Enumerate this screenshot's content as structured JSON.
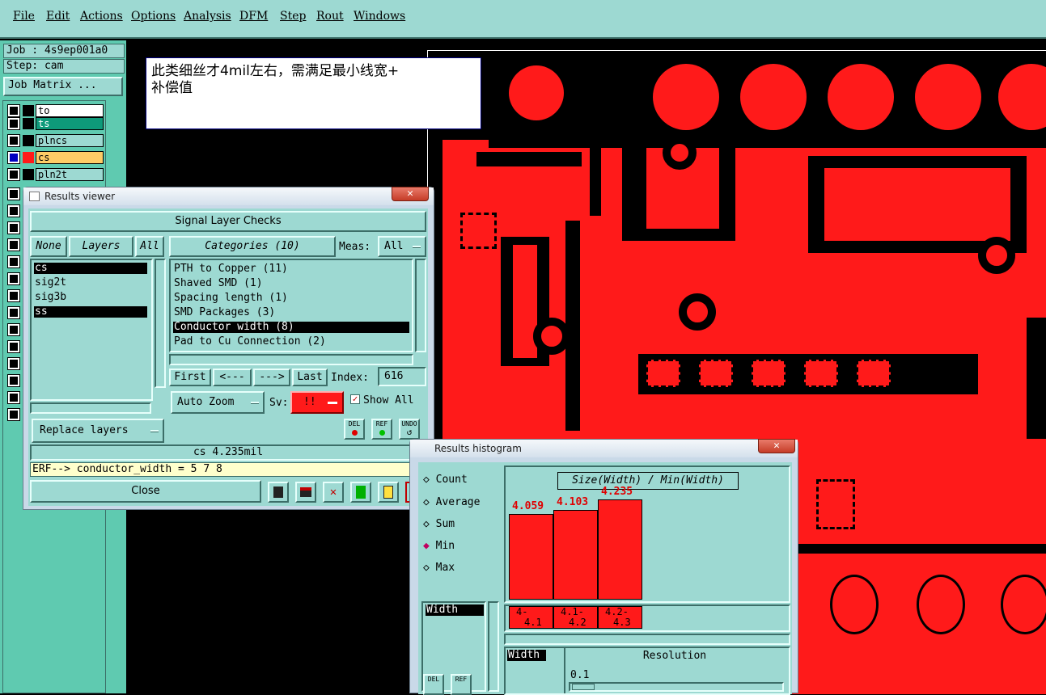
{
  "menu": [
    "File",
    "Edit",
    "Actions",
    "Options",
    "Analysis",
    "DFM",
    "Step",
    "Rout",
    "Windows"
  ],
  "job": {
    "job_label": "Job : 4s9ep001a0",
    "step_label": "Step: cam",
    "matrix_button": "Job Matrix ..."
  },
  "layers": [
    "to",
    "ts",
    "plncs",
    "cs",
    "pln2t"
  ],
  "note": {
    "line1": "此类细丝才4mil左右，需满足最小线宽+",
    "line2": "补偿值"
  },
  "results_viewer": {
    "title": "Results viewer",
    "close_symbol": "✕",
    "header": "Signal Layer Checks",
    "none_btn": "None",
    "layers_btn": "Layers",
    "all_btn": "All",
    "layer_list": [
      "cs",
      "sig2t",
      "sig3b",
      "ss"
    ],
    "categories_btn": "Categories (10)",
    "meas_label": "Meas:",
    "meas_value": "All",
    "categories": [
      "PTH to Copper (11)",
      "Shaved SMD (1)",
      "Spacing length (1)",
      "SMD Packages (3)",
      "Conductor width (8)",
      "Pad to Cu Connection (2)"
    ],
    "nav": {
      "first": "First",
      "prev": "<---",
      "next": "--->",
      "last": "Last",
      "index_label": "Index:",
      "index_value": "616"
    },
    "auto_zoom": "Auto Zoom",
    "sv_label": "Sv:",
    "sv_value": "!!",
    "show_all": "Show All",
    "replace_layers": "Replace layers",
    "del": "DEL",
    "ref": "REF",
    "undo": "UNDO",
    "status": "cs 4.235mil",
    "erf": "ERF--> conductor_width = 5 7 8",
    "close": "Close"
  },
  "histogram": {
    "title": "Results histogram",
    "close_symbol": "✕",
    "options": [
      "Count",
      "Average",
      "Sum",
      "Min",
      "Max"
    ],
    "selected_option": "Min",
    "list_item": "Width",
    "chart_title": "Size(Width) / Min(Width)",
    "width_label": "Width",
    "resolution_label": "Resolution",
    "resolution_value": "0.1",
    "del": "DEL",
    "ref": "REF"
  },
  "chart_data": {
    "type": "bar",
    "title": "Size(Width) / Min(Width)",
    "categories": [
      "4-4.1",
      "4.1-4.2",
      "4.2-4.3"
    ],
    "category_labels": [
      [
        "4-",
        "4.1"
      ],
      [
        "4.1-",
        "4.2"
      ],
      [
        "4.2-",
        "4.3"
      ]
    ],
    "values": [
      4.059,
      4.103,
      4.235
    ],
    "value_labels": [
      "4.059",
      "4.103",
      "4.235"
    ],
    "colors": {
      "bar": "#ff1a1a",
      "label": "#e00000"
    }
  }
}
